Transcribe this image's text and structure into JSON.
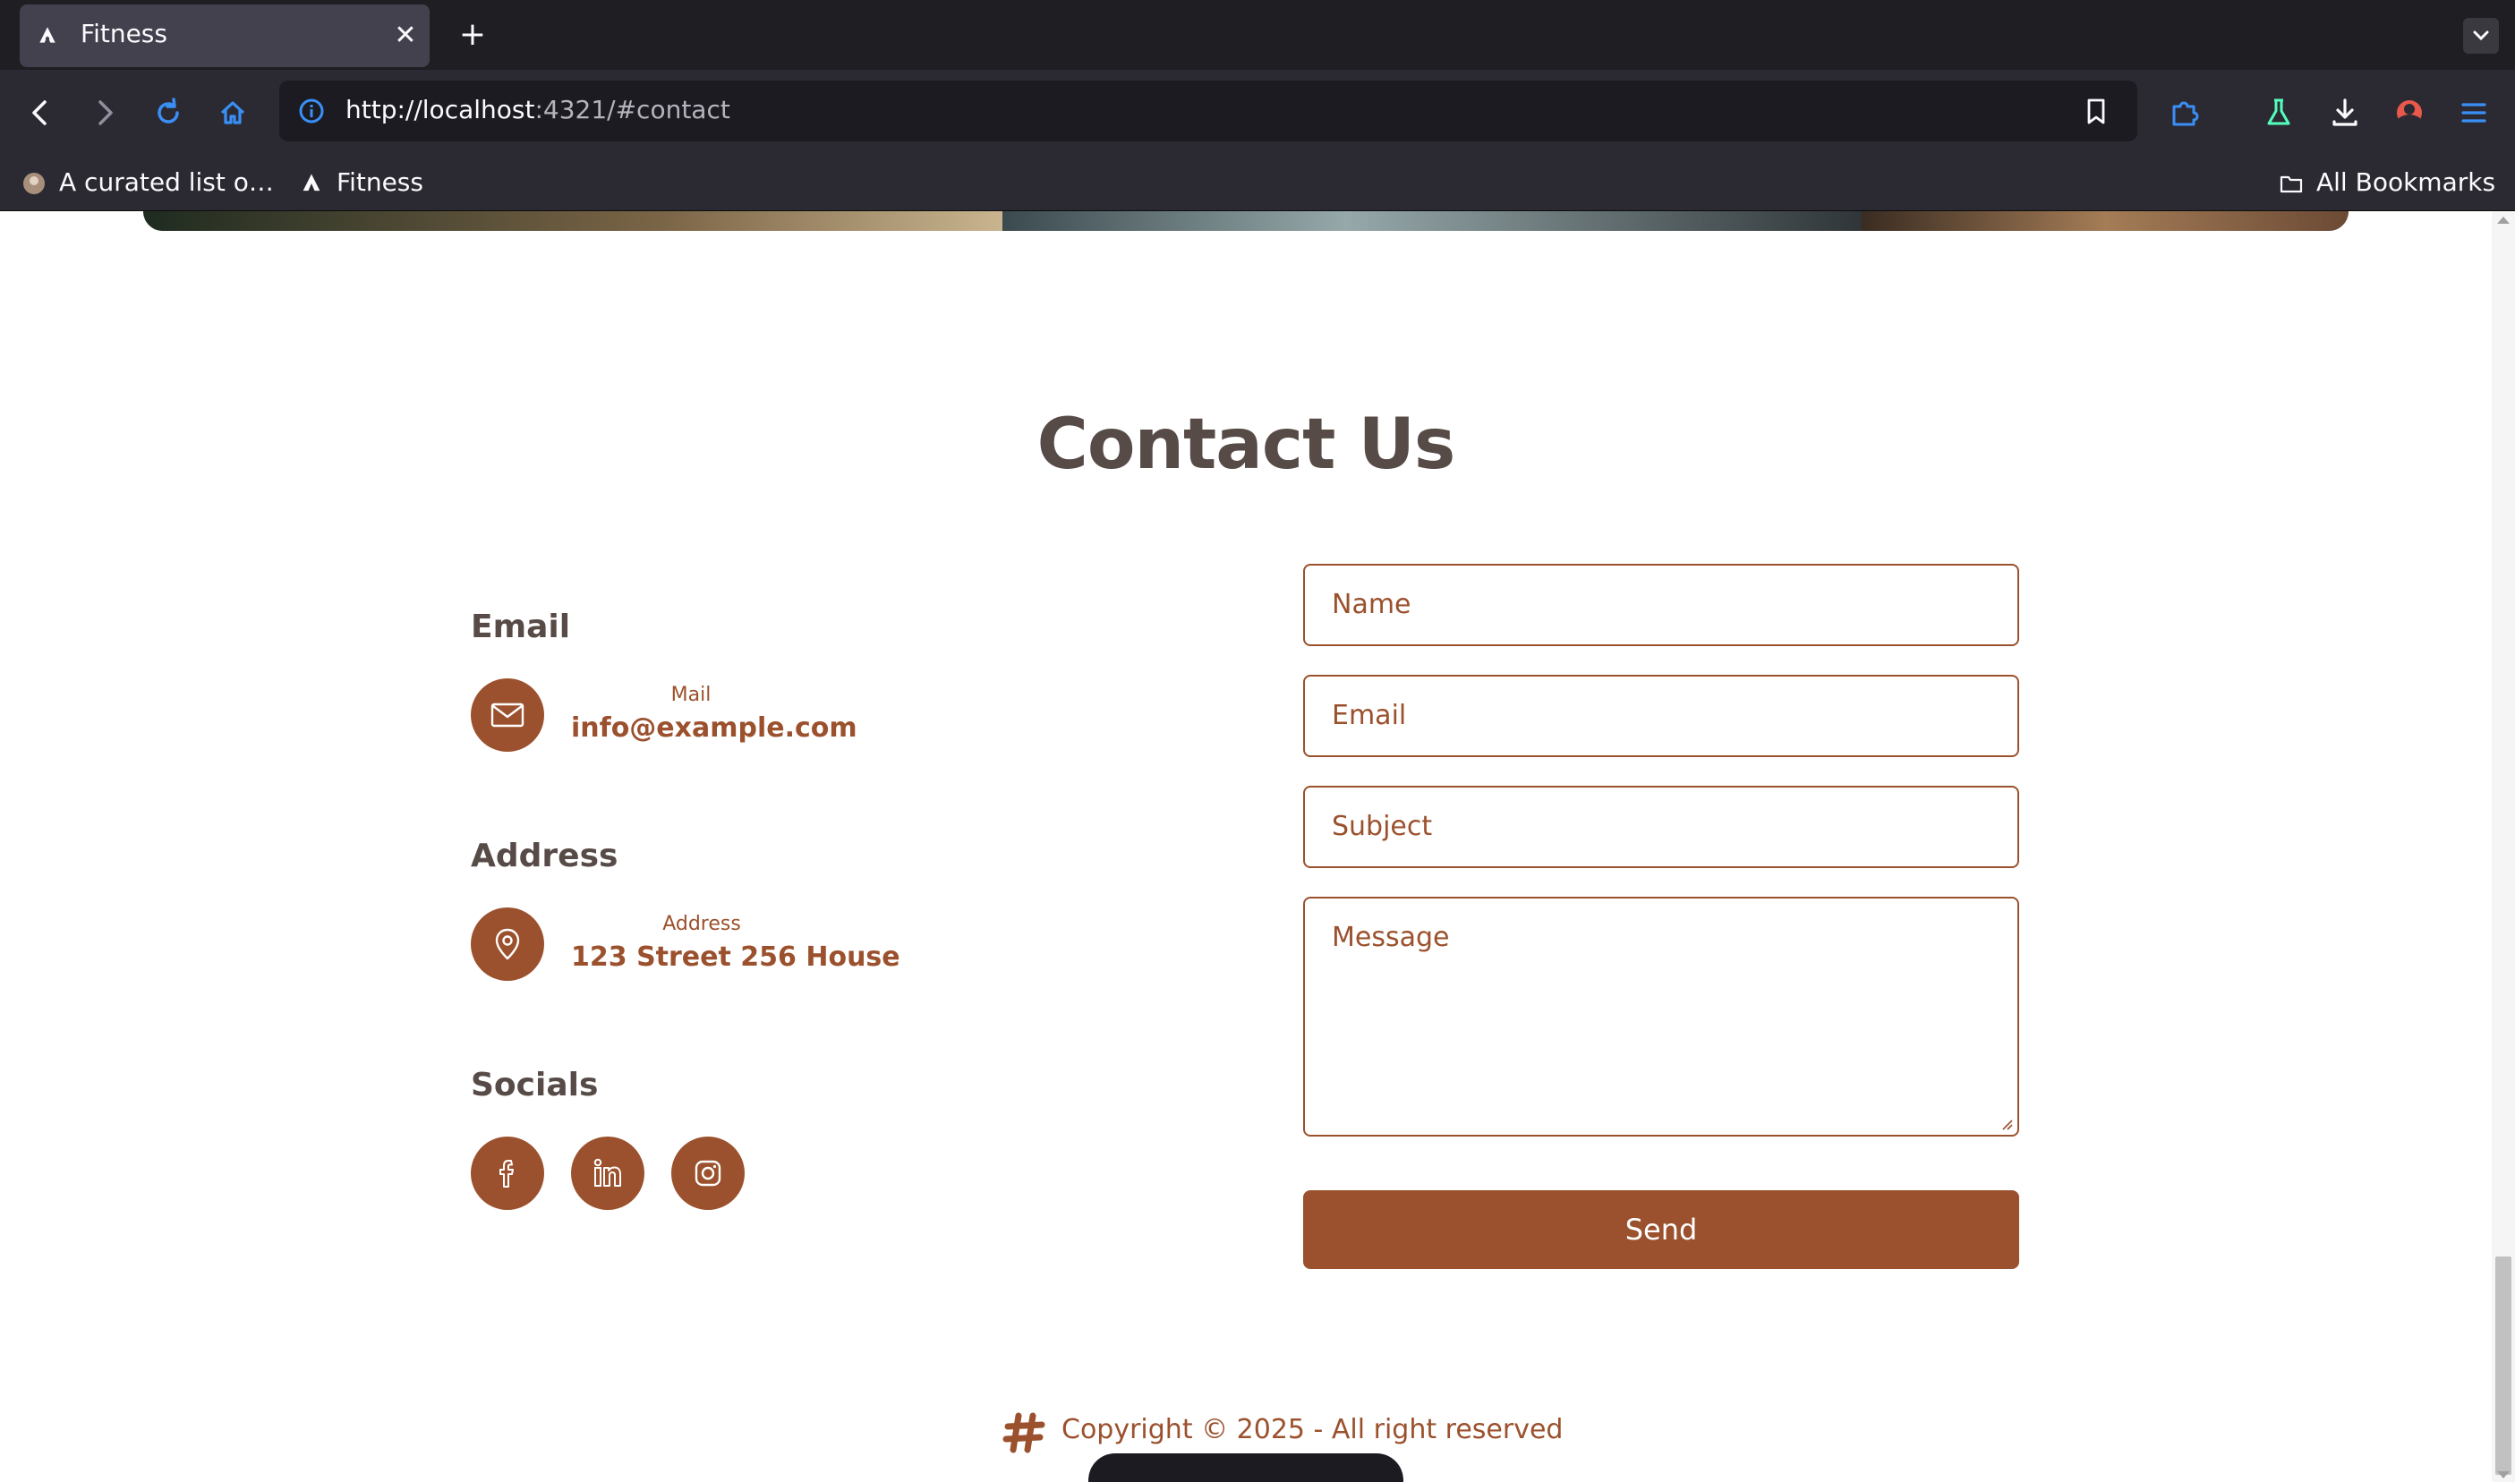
{
  "browser": {
    "tab": {
      "title": "Fitness",
      "close_glyph": "✕"
    },
    "new_tab_glyph": "+",
    "url": {
      "host": "http://localhost",
      "rest": ":4321/#contact"
    },
    "bookmarks": [
      {
        "label": "A curated list o…",
        "icon": "globe-avatar-icon"
      },
      {
        "label": "Fitness",
        "icon": "site-favicon-icon"
      }
    ],
    "all_bookmarks": "All Bookmarks",
    "icons": [
      "back-icon",
      "forward-icon",
      "reload-icon",
      "home-icon",
      "info-icon",
      "bookmark-star-icon",
      "extensions-icon",
      "labs-icon",
      "download-icon",
      "profile-icon",
      "menu-icon"
    ]
  },
  "page": {
    "title": "Contact Us",
    "email_group": {
      "title": "Email",
      "label": "Mail",
      "value": "info@example.com",
      "icon": "mail-icon"
    },
    "address_group": {
      "title": "Address",
      "label": "Address",
      "value": "123 Street 256 House",
      "icon": "location-pin-icon"
    },
    "socials_group": {
      "title": "Socials",
      "icons": [
        "facebook-icon",
        "linkedin-icon",
        "instagram-icon"
      ]
    },
    "form": {
      "name_placeholder": "Name",
      "email_placeholder": "Email",
      "subject_placeholder": "Subject",
      "message_placeholder": "Message",
      "send_label": "Send"
    },
    "footer": {
      "copyright": "Copyright © 2025 - All right reserved",
      "logo_icon": "hash-logo-icon"
    }
  },
  "colors": {
    "accent": "#9b512d",
    "heading": "#574b47",
    "chrome_dark": "#2b2a33",
    "tabbar": "#1f1e23"
  }
}
